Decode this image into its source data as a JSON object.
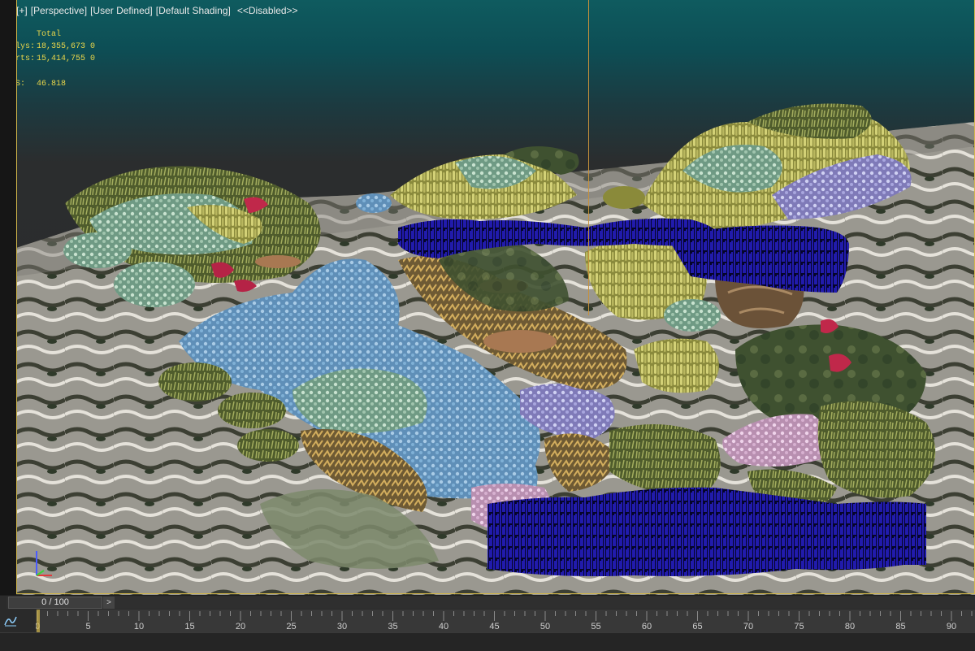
{
  "viewport": {
    "labels": [
      "[+]",
      "[Perspective]",
      "[User Defined]",
      "[Default Shading]",
      "<<Disabled>>"
    ],
    "stats": {
      "header": "Total",
      "polys_label": "Polys:",
      "polys_value": "18,355,673",
      "polys_sel": "0",
      "verts_label": "Verts:",
      "verts_value": "15,414,755",
      "verts_sel": "0",
      "fps_label": "FPS:",
      "fps_value": "46.818"
    }
  },
  "timeline": {
    "prev_label": "<",
    "frame_display": "0 / 100",
    "next_label": ">",
    "current_frame": 0,
    "total_frames": 100,
    "ruler_ticks": [
      0,
      5,
      10,
      15,
      20,
      25,
      30,
      35,
      40,
      45,
      50,
      55,
      60,
      65,
      70,
      75,
      80,
      85,
      90
    ]
  },
  "colors": {
    "accent": "#d4b84a",
    "stats_text": "#e9d64a",
    "selection_blue": "#1a16a8"
  },
  "icons": [
    "curve-editor-icon",
    "axis-gizmo-icon"
  ]
}
